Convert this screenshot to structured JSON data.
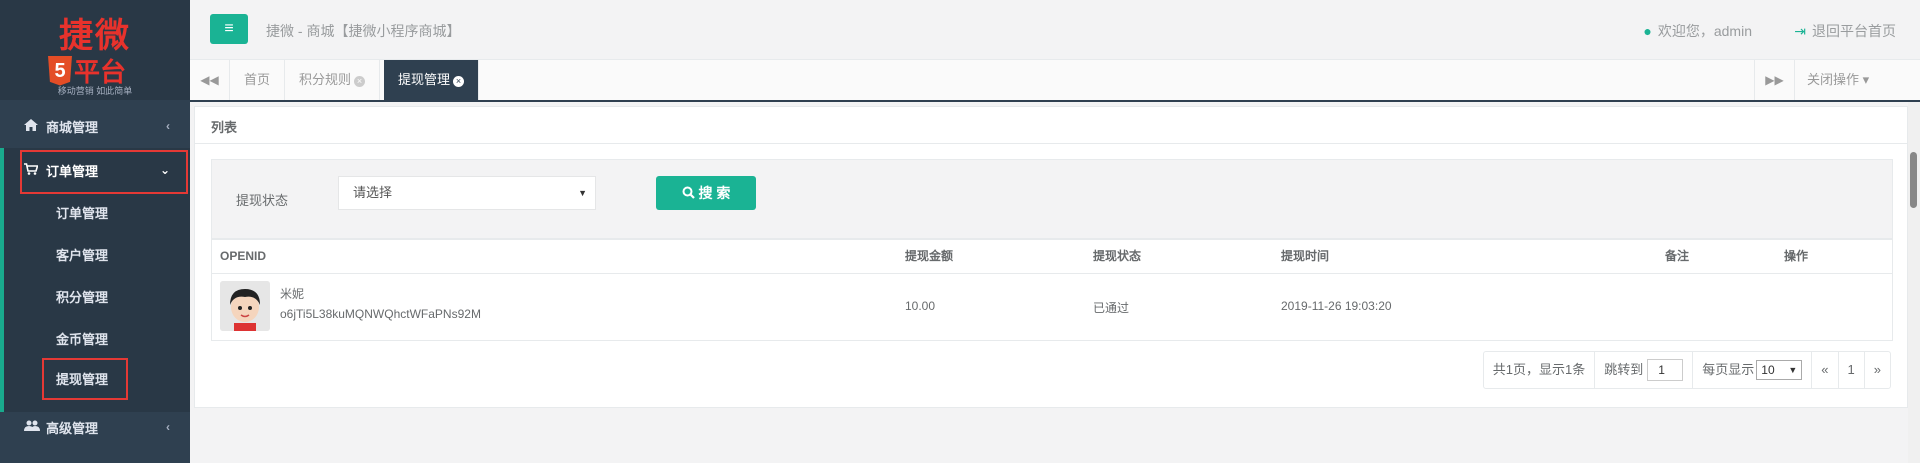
{
  "logo": {
    "brand": "捷微",
    "html5": "5",
    "platform": "平台",
    "slogan": "移动营销 如此简单"
  },
  "sidebar": {
    "mall": {
      "label": "商城管理",
      "icon": "home-icon"
    },
    "order": {
      "label": "订单管理",
      "icon": "cart-icon"
    },
    "sub_items": [
      "订单管理",
      "客户管理",
      "积分管理",
      "金币管理",
      "提现管理"
    ],
    "advanced": {
      "label": "高级管理",
      "icon": "users-icon"
    }
  },
  "topbar": {
    "crumb": "捷微 - 商城【捷微小程序商城】",
    "welcome": "欢迎您，admin",
    "exit": "退回平台首页"
  },
  "tabs": {
    "items": [
      "首页",
      "积分规则",
      "提现管理"
    ],
    "active": "提现管理",
    "close_ops": "关闭操作"
  },
  "panel": {
    "title": "列表",
    "search": {
      "status_label": "提现状态",
      "status_value": "请选择",
      "button": "搜 索"
    },
    "table": {
      "headers": [
        "OPENID",
        "提现金额",
        "提现状态",
        "提现时间",
        "备注",
        "操作"
      ],
      "rows": [
        {
          "name": "米妮",
          "openid": "o6jTi5L38kuMQNWQhctWFaPNs92M",
          "amount": "10.00",
          "status": "已通过",
          "time": "2019-11-26 19:03:20",
          "remark": "",
          "ops": ""
        }
      ]
    },
    "pager": {
      "summary": "共1页，显示1条",
      "jump_label": "跳转到",
      "jump_value": "1",
      "per_page_label": "每页显示",
      "per_page_value": "10",
      "prev": "«",
      "current": "1",
      "next": "»"
    }
  },
  "colors": {
    "accent": "#1ab394",
    "sidebar": "#2f4050",
    "highlight_box": "#e53935"
  }
}
